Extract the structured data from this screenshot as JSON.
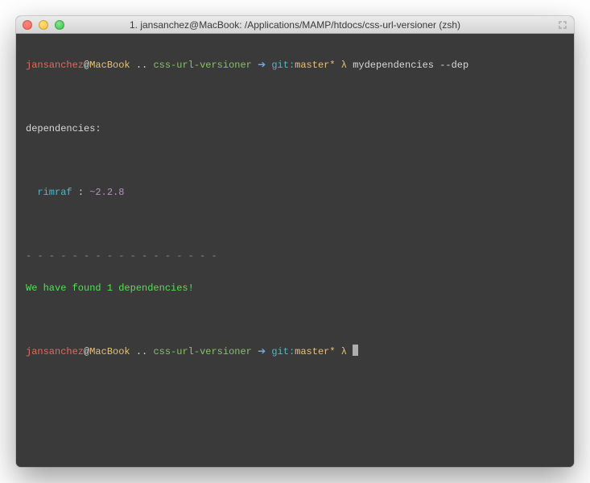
{
  "window": {
    "title": "1. jansanchez@MacBook: /Applications/MAMP/htdocs/css-url-versioner (zsh)"
  },
  "prompt": {
    "user": "jansanchez",
    "at": "@",
    "host": "MacBook",
    "sep": " .. ",
    "dir": "css-url-versioner",
    "arrow": " ➔ ",
    "git_label": "git:",
    "git_branch": "master*",
    "lambda": " λ "
  },
  "command": "mydependencies --dep",
  "output": {
    "blank": " ",
    "header": "dependencies:",
    "pkg_indent": "  ",
    "pkg_name": "rimraf",
    "pkg_colon": " : ",
    "pkg_version": "~2.2.8",
    "dashes": "- - - - - - - - - - - - - - - - -",
    "found": "We have found 1 dependencies!"
  }
}
